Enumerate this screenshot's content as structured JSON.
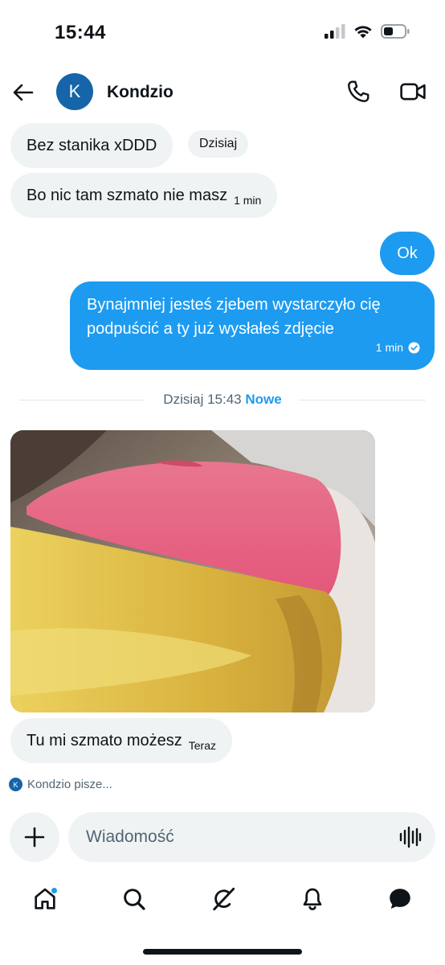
{
  "status_bar": {
    "time": "15:44"
  },
  "header": {
    "avatar_letter": "K",
    "contact_name": "Kondzio"
  },
  "messages": [
    {
      "text": "Bez stanika xDDD",
      "badge": "Dzisiaj"
    },
    {
      "text": "Bo nic tam szmato nie masz",
      "time": "1 min"
    },
    {
      "text": "Ok"
    },
    {
      "line1": "Bynajmniej jesteś zjebem wystarczyło cię",
      "line2": "podpuścić a ty już wysłałeś zdjęcie",
      "time": "1 min"
    },
    {
      "text": "Tu mi szmato możesz",
      "time": "Teraz"
    }
  ],
  "divider": {
    "date": "Dzisiaj 15:43",
    "new_label": "Nowe"
  },
  "typing": {
    "avatar_letter": "K",
    "text": "Kondzio pisze..."
  },
  "composer": {
    "placeholder": "Wiadomość"
  },
  "colors": {
    "accent": "#1d9bf0",
    "avatar_bg": "#1565a8",
    "bubble_in": "#eff3f4"
  },
  "tabbar": {
    "icons": [
      "home-icon",
      "search-icon",
      "grok-icon",
      "notifications-icon",
      "messages-icon"
    ]
  }
}
